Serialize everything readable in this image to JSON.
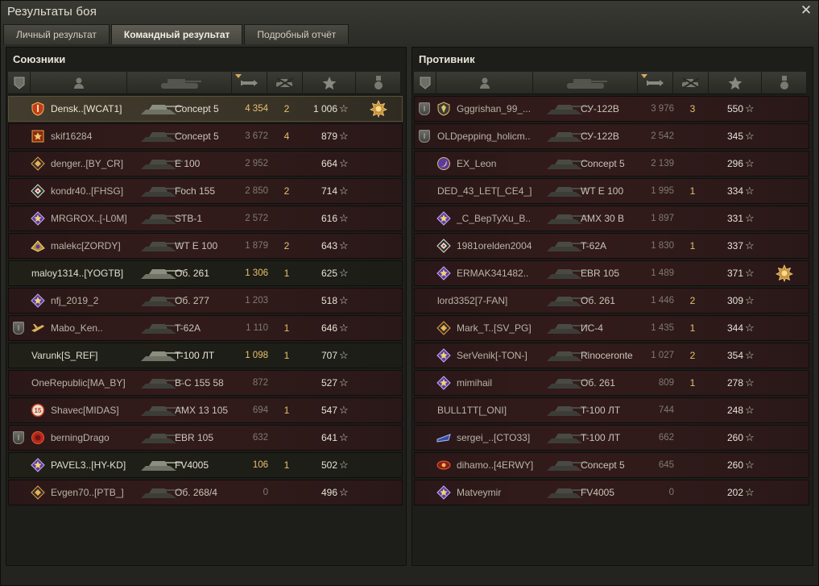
{
  "window": {
    "title": "Результаты боя"
  },
  "tabs": [
    {
      "label": "Личный результат",
      "active": false
    },
    {
      "label": "Командный результат",
      "active": true
    },
    {
      "label": "Подробный отчёт",
      "active": false
    }
  ],
  "colors": {
    "accent_gold": "#e8c06c",
    "dead_row": "#331b1b",
    "alive_row": "#1d1d18",
    "self_row": "#3a3428"
  },
  "allies": {
    "title": "Союзники",
    "columns": [
      "platoon-icon",
      "player-icon",
      "tank-icon",
      "damage-icon",
      "kills-icon",
      "xp-star-icon",
      "medal-icon"
    ],
    "rows": [
      {
        "platoon": false,
        "badge": "red-shield",
        "name": "Densk..[WCAT1]",
        "tank": "Concept 5",
        "damage": "4 354",
        "kills": "2",
        "xp": "1 006",
        "medal": true,
        "state": "self"
      },
      {
        "platoon": false,
        "badge": "orange-square",
        "name": "skif16284",
        "tank": "Concept 5",
        "damage": "3 672",
        "kills": "4",
        "xp": "879",
        "medal": false,
        "state": "dead"
      },
      {
        "platoon": false,
        "badge": "diamond-orange",
        "name": "denger..[BY_CR]",
        "tank": "E 100",
        "damage": "2 952",
        "kills": "",
        "xp": "664",
        "medal": false,
        "state": "dead"
      },
      {
        "platoon": false,
        "badge": "diamond-white",
        "name": "kondr40..[FHSG]",
        "tank": "Foch 155",
        "damage": "2 850",
        "kills": "2",
        "xp": "714",
        "medal": false,
        "state": "dead"
      },
      {
        "platoon": false,
        "badge": "purple-star",
        "name": "MRGROX..[-L0M]",
        "tank": "STB-1",
        "damage": "2 572",
        "kills": "",
        "xp": "616",
        "medal": false,
        "state": "dead"
      },
      {
        "platoon": false,
        "badge": "gold-wing",
        "name": "malekc[ZORDY]",
        "tank": "WT E 100",
        "damage": "1 879",
        "kills": "2",
        "xp": "643",
        "medal": false,
        "state": "dead"
      },
      {
        "platoon": false,
        "badge": "",
        "name": "maloy1314..[YOGTB]",
        "tank": "Об. 261",
        "damage": "1 306",
        "kills": "1",
        "xp": "625",
        "medal": false,
        "state": "alive"
      },
      {
        "platoon": false,
        "badge": "purple-star",
        "name": "nfj_2019_2",
        "tank": "Об. 277",
        "damage": "1 203",
        "kills": "",
        "xp": "518",
        "medal": false,
        "state": "dead"
      },
      {
        "platoon": true,
        "badge": "plane",
        "name": "Mabo_Ken..",
        "tank": "T-62A",
        "damage": "1 110",
        "kills": "1",
        "xp": "646",
        "medal": false,
        "state": "dead"
      },
      {
        "platoon": false,
        "badge": "",
        "name": "Varunk[S_REF]",
        "tank": "T-100 ЛТ",
        "damage": "1 098",
        "kills": "1",
        "xp": "707",
        "medal": false,
        "state": "alive"
      },
      {
        "platoon": false,
        "badge": "",
        "name": "OneRepublic[MA_BY]",
        "tank": "B-C 155 58",
        "damage": "872",
        "kills": "",
        "xp": "527",
        "medal": false,
        "state": "dead"
      },
      {
        "platoon": false,
        "badge": "red-15",
        "name": "Shavec[MIDAS]",
        "tank": "AMX 13 105",
        "damage": "694",
        "kills": "1",
        "xp": "547",
        "medal": false,
        "state": "dead"
      },
      {
        "platoon": true,
        "badge": "red-circle",
        "name": "berningDrago",
        "tank": "EBR 105",
        "damage": "632",
        "kills": "",
        "xp": "641",
        "medal": false,
        "state": "dead"
      },
      {
        "platoon": false,
        "badge": "purple-star",
        "name": "PAVEL3..[HY-KD]",
        "tank": "FV4005",
        "damage": "106",
        "kills": "1",
        "xp": "502",
        "medal": false,
        "state": "alive"
      },
      {
        "platoon": false,
        "badge": "diamond-orange",
        "name": "Evgen70..[PTB_]",
        "tank": "Об. 268/4",
        "damage": "0",
        "kills": "",
        "xp": "496",
        "medal": false,
        "state": "dead"
      }
    ]
  },
  "enemies": {
    "title": "Противник",
    "columns": [
      "platoon-icon",
      "player-icon",
      "tank-icon",
      "damage-icon",
      "kills-icon",
      "xp-star-icon",
      "medal-icon"
    ],
    "rows": [
      {
        "platoon": true,
        "badge": "gold-shield",
        "name": "Gggrishan_99_...",
        "tank": "СУ-122В",
        "damage": "3 976",
        "kills": "3",
        "xp": "550",
        "medal": false,
        "state": "dead"
      },
      {
        "platoon": true,
        "badge": "",
        "name": "OLDpepping_holicm..",
        "tank": "СУ-122В",
        "damage": "2 542",
        "kills": "",
        "xp": "345",
        "medal": false,
        "state": "dead"
      },
      {
        "platoon": false,
        "badge": "gold-crescent",
        "name": "EX_Leon",
        "tank": "Concept 5",
        "damage": "2 139",
        "kills": "",
        "xp": "296",
        "medal": false,
        "state": "dead"
      },
      {
        "platoon": false,
        "badge": "",
        "name": "DED_43_LET[_CE4_]",
        "tank": "WT E 100",
        "damage": "1 995",
        "kills": "1",
        "xp": "334",
        "medal": false,
        "state": "dead"
      },
      {
        "platoon": false,
        "badge": "purple-star",
        "name": "_C_BepTyXu_B..",
        "tank": "AMX 30 B",
        "damage": "1 897",
        "kills": "",
        "xp": "331",
        "medal": false,
        "state": "dead"
      },
      {
        "platoon": false,
        "badge": "diamond-white",
        "name": "1981orelden2004",
        "tank": "T-62A",
        "damage": "1 830",
        "kills": "1",
        "xp": "337",
        "medal": false,
        "state": "dead"
      },
      {
        "platoon": false,
        "badge": "purple-star",
        "name": "ERMAK341482..",
        "tank": "EBR 105",
        "damage": "1 489",
        "kills": "",
        "xp": "371",
        "medal": true,
        "state": "dead"
      },
      {
        "platoon": false,
        "badge": "",
        "name": "lord3352[7-FAN]",
        "tank": "Об. 261",
        "damage": "1 446",
        "kills": "2",
        "xp": "309",
        "medal": false,
        "state": "dead"
      },
      {
        "platoon": false,
        "badge": "diamond-orange",
        "name": "Mark_T..[SV_PG]",
        "tank": "ИС-4",
        "damage": "1 435",
        "kills": "1",
        "xp": "344",
        "medal": false,
        "state": "dead"
      },
      {
        "platoon": false,
        "badge": "purple-star",
        "name": "SerVenik[-TON-]",
        "tank": "Rinoceronte",
        "damage": "1 027",
        "kills": "2",
        "xp": "354",
        "medal": false,
        "state": "dead"
      },
      {
        "platoon": false,
        "badge": "purple-star",
        "name": "mimihail",
        "tank": "Об. 261",
        "damage": "809",
        "kills": "1",
        "xp": "278",
        "medal": false,
        "state": "dead"
      },
      {
        "platoon": false,
        "badge": "",
        "name": "BULL1TT[_ONI]",
        "tank": "T-100 ЛТ",
        "damage": "744",
        "kills": "",
        "xp": "248",
        "medal": false,
        "state": "dead"
      },
      {
        "platoon": false,
        "badge": "blue-wing",
        "name": "sergei_..[CTO33]",
        "tank": "T-100 ЛТ",
        "damage": "662",
        "kills": "",
        "xp": "260",
        "medal": false,
        "state": "dead"
      },
      {
        "platoon": false,
        "badge": "red-eye",
        "name": "dihamo..[4ERWY]",
        "tank": "Concept 5",
        "damage": "645",
        "kills": "",
        "xp": "260",
        "medal": false,
        "state": "dead"
      },
      {
        "platoon": false,
        "badge": "purple-star",
        "name": "Matveymir",
        "tank": "FV4005",
        "damage": "0",
        "kills": "",
        "xp": "202",
        "medal": false,
        "state": "dead"
      }
    ]
  }
}
